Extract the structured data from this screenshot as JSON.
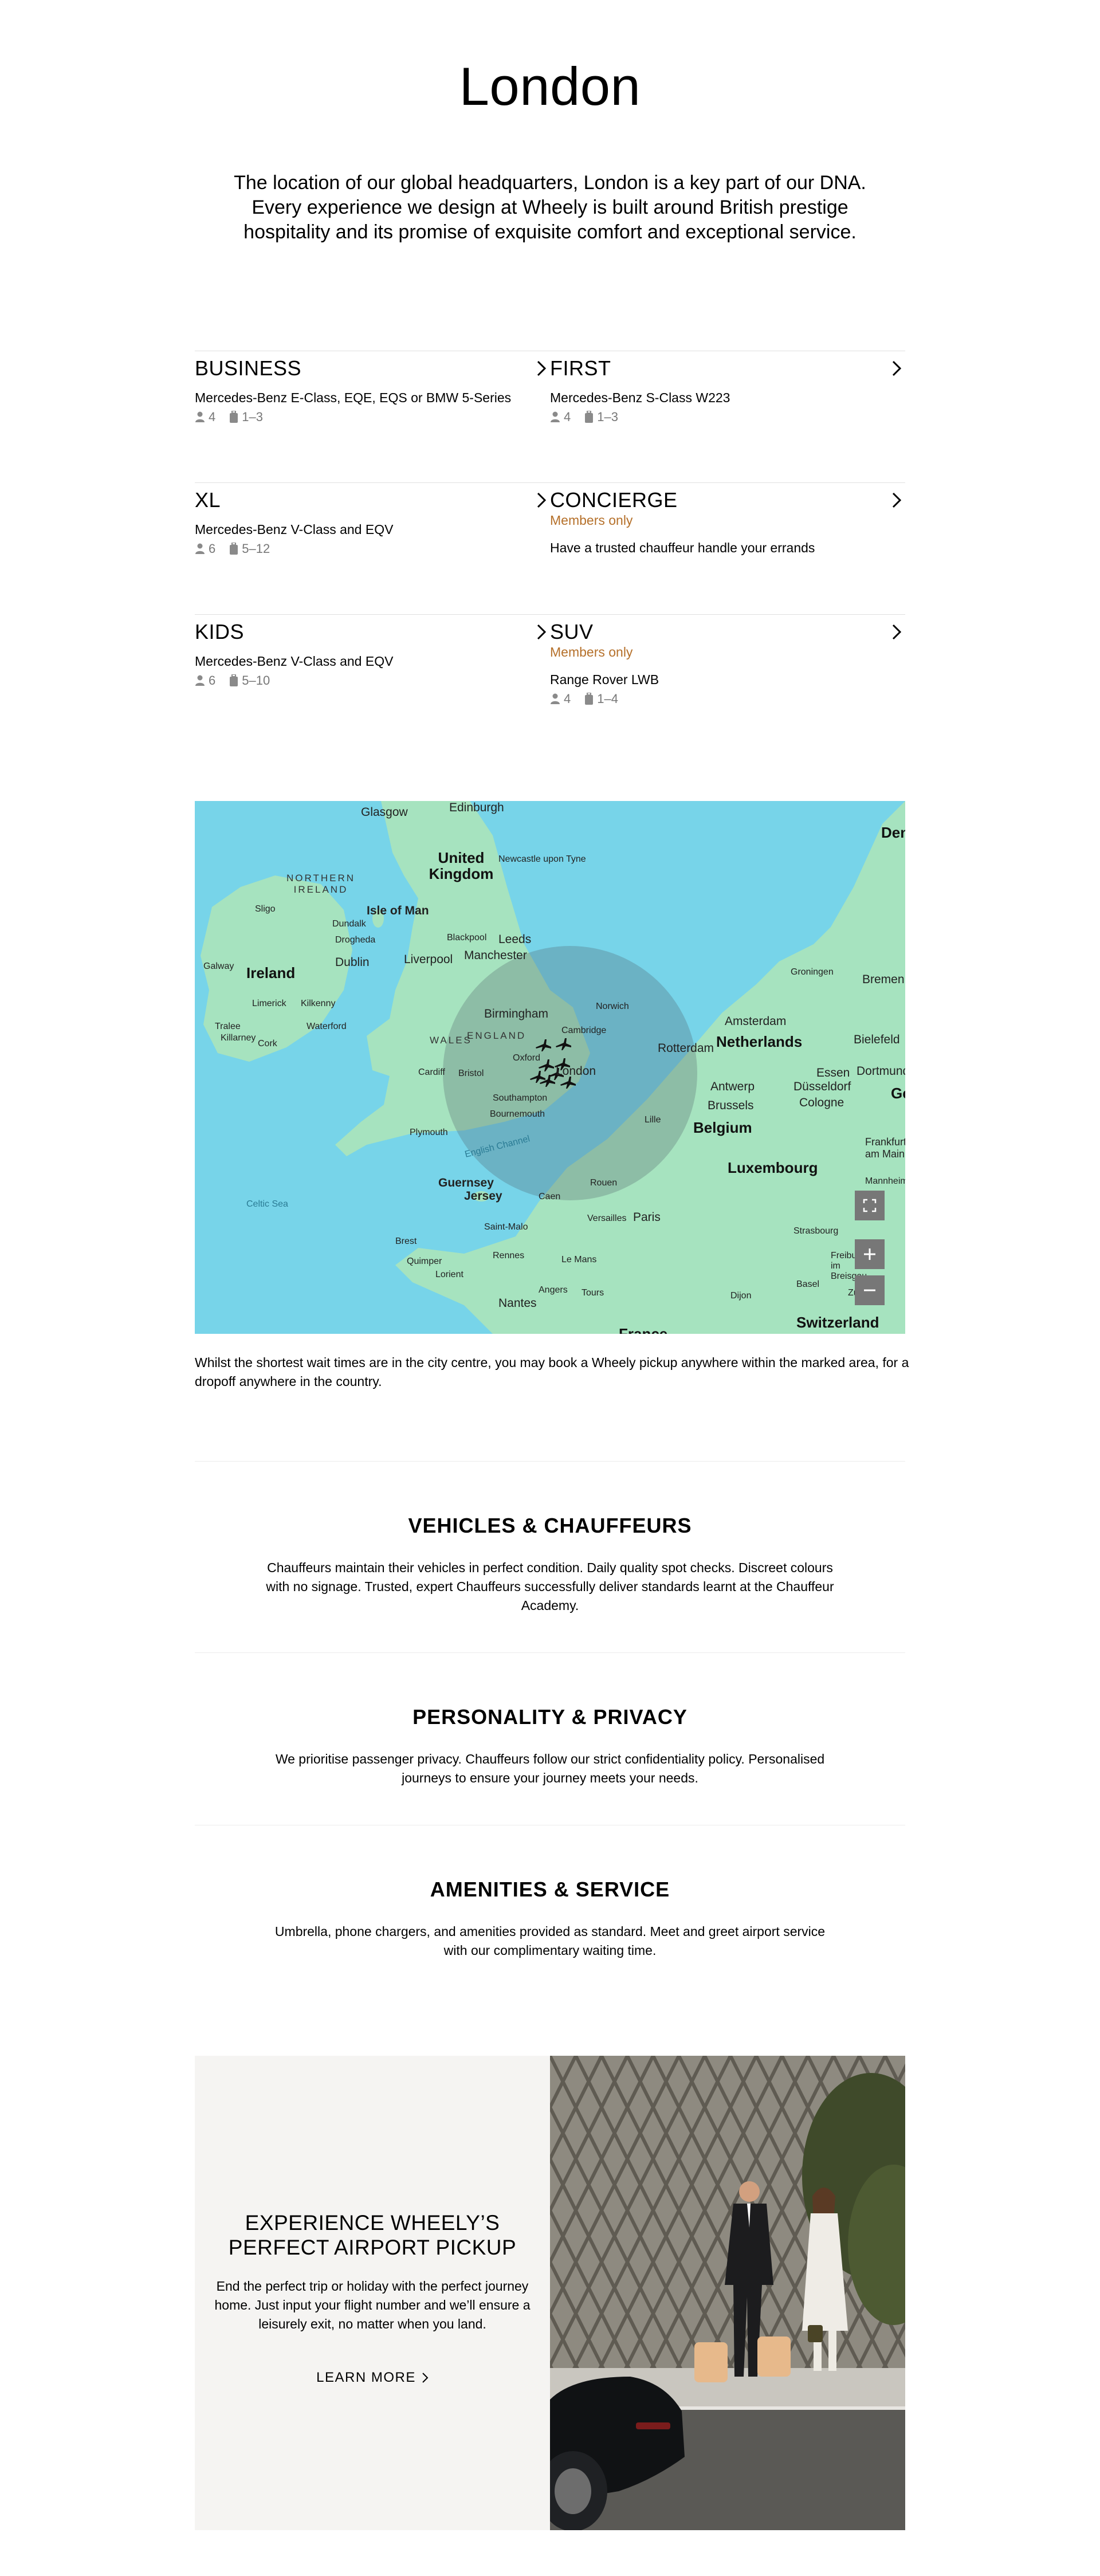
{
  "header": {
    "title": "London",
    "intro": "The location of our global headquarters, London is a key part of our DNA. Every experience we design at Wheely is built around British prestige hospitality and its promise of exquisite comfort and exceptional service."
  },
  "classes": [
    {
      "name": "BUSINESS",
      "members": "",
      "description": "Mercedes-Benz E-Class, EQE, EQS or BMW 5-Series",
      "passengers": "4",
      "luggage": "1–3"
    },
    {
      "name": "FIRST",
      "members": "",
      "description": "Mercedes-Benz S-Class W223",
      "passengers": "4",
      "luggage": "1–3"
    },
    {
      "name": "XL",
      "members": "",
      "description": "Mercedes-Benz V-Class and EQV",
      "passengers": "6",
      "luggage": "5–12"
    },
    {
      "name": "CONCIERGE",
      "members": "Members only",
      "description": "Have a trusted chauffeur handle your errands",
      "passengers": "",
      "luggage": ""
    },
    {
      "name": "KIDS",
      "members": "",
      "description": "Mercedes-Benz V-Class and EQV",
      "passengers": "6",
      "luggage": "5–10"
    },
    {
      "name": "SUV",
      "members": "Members only",
      "description": "Range Rover LWB",
      "passengers": "4",
      "luggage": "1–4"
    }
  ],
  "map": {
    "labels": {
      "edinburgh": "Edinburgh",
      "glasgow": "Glasgow",
      "newcastle": "Newcastle upon Tyne",
      "uk": "United Kingdom",
      "northern_ireland": "NORTHERN IRELAND",
      "isle_of_man": "Isle of Man",
      "sligo": "Sligo",
      "dundalk": "Dundalk",
      "drogheda": "Drogheda",
      "dublin": "Dublin",
      "ireland": "Ireland",
      "galway": "Galway",
      "limerick": "Limerick",
      "kilkenny": "Kilkenny",
      "waterford": "Waterford",
      "tralee": "Tralee",
      "killarney": "Killarney",
      "cork": "Cork",
      "blackpool": "Blackpool",
      "leeds": "Leeds",
      "liverpool": "Liverpool",
      "manchester": "Manchester",
      "wales": "WALES",
      "birmingham": "Birmingham",
      "england": "ENGLAND",
      "norwich": "Norwich",
      "cambridge": "Cambridge",
      "cardiff": "Cardiff",
      "bristol": "Bristol",
      "oxford": "Oxford",
      "london": "London",
      "southampton": "Southampton",
      "bournemouth": "Bournemouth",
      "plymouth": "Plymouth",
      "english_channel": "English Channel",
      "celtic_sea": "Celtic Sea",
      "guernsey": "Guernsey",
      "jersey": "Jersey",
      "caen": "Caen",
      "rouen": "Rouen",
      "brest": "Brest",
      "quimper": "Quimper",
      "lorient": "Lorient",
      "saint_malo": "Saint-Malo",
      "rennes": "Rennes",
      "le_mans": "Le Mans",
      "versailles": "Versailles",
      "paris": "Paris",
      "nantes": "Nantes",
      "angers": "Angers",
      "tours": "Tours",
      "france": "France",
      "dijon": "Dijon",
      "amsterdam": "Amsterdam",
      "netherlands": "Netherlands",
      "rotterdam": "Rotterdam",
      "essen": "Essen",
      "dortmund": "Dortmund",
      "antwerp": "Antwerp",
      "dusseldorf": "Düsseldorf",
      "brussels": "Brussels",
      "cologne": "Cologne",
      "lille": "Lille",
      "belgium": "Belgium",
      "luxembourg": "Luxembourg",
      "groningen": "Groningen",
      "bremen": "Bremen",
      "bielefeld": "Bielefeld",
      "frankfurt": "Frankfurt am Main",
      "mannheim": "Mannheim",
      "strasbourg": "Strasbourg",
      "freiburg": "Freiburg im Breisgau",
      "basel": "Basel",
      "zurich": "Zürich",
      "switzerland": "Switzerland",
      "denmark": "Den",
      "germany": "Ge"
    },
    "note": "Whilst the shortest wait times are in the city centre, you may book a Wheely pickup anywhere within the marked area, for a dropoff anywhere in the country."
  },
  "features": [
    {
      "title": "VEHICLES & CHAUFFEURS",
      "text": "Chauffeurs maintain their vehicles in perfect condition. Daily quality spot checks. Discreet colours with no signage. Trusted, expert Chauffeurs successfully deliver standards learnt at the Chauffeur Academy."
    },
    {
      "title": "PERSONALITY & PRIVACY",
      "text": "We prioritise passenger privacy. Chauffeurs follow our strict confidentiality policy. Personalised journeys to ensure your journey meets your needs."
    },
    {
      "title": "AMENITIES & SERVICE",
      "text": "Umbrella, phone chargers, and amenities provided as standard. Meet and greet airport service with our complimentary waiting time."
    }
  ],
  "promo": {
    "title": "EXPERIENCE WHEELY’S PERFECT AIRPORT PICKUP",
    "text": "End the perfect trip or holiday with the perfect journey home. Just input your flight number and we’ll ensure a leisurely exit, no matter when you land.",
    "cta": "LEARN MORE"
  },
  "colors": {
    "accent": "#b5702a",
    "water": "#77d4e9",
    "land": "#a6e3bf",
    "promo_bg": "#f5f4f2"
  }
}
